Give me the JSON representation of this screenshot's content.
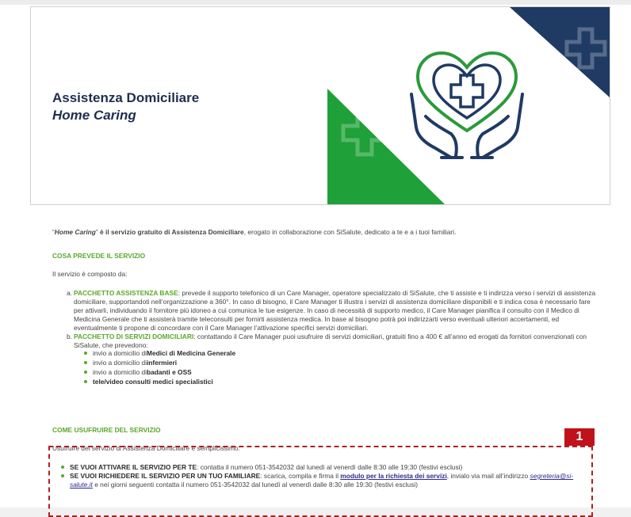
{
  "hero": {
    "title": "Assistenza Domiciliare",
    "subtitle": "Home Caring"
  },
  "intro": {
    "quote_open": "“",
    "name": "Home Caring",
    "quote_close": "”",
    "mid1": " è il servizio gratuito di ",
    "bold": "Assistenza Domiciliare",
    "rest": ", erogato in collaborazione con SiSalute, dedicato a te e a i tuoi familiari."
  },
  "section1": {
    "heading": "COSA PREVEDE IL SERVIZIO",
    "composed": "Il servizio è composto da:",
    "items": [
      {
        "marker": "a.",
        "title": "PACCHETTO ASSISTENZA BASE",
        "text": ": prevede il supporto telefonico di un Care Manager, operatore specializzato di SiSalute, che ti assiste e ti indirizza verso i servizi di assistenza domiciliare, supportandoti nell’organizzazione a 360°. In caso di bisogno, il Care Manager ti illustra i servizi di assistenza domiciliare disponibili e ti indica cosa è necessario fare per attivarli, individuando il fornitore più idoneo a cui comunica le tue esigenze. In caso di necessità di supporto medico, il Care Manager pianifica il consulto con il Medico di Medicina Generale che ti assisterà tramite teleconsulti per fornirti assistenza medica. In base al bisogno potrà poi indirizzarti verso eventuali ulteriori accertamenti, ed eventualmente ti propone di concordare con il Care Manager l’attivazione specifici servizi domiciliari."
      },
      {
        "marker": "b.",
        "title": "PACCHETTO DI SERVIZI DOMICILIARI",
        "text": ": contattando il Care Manager puoi usufruire di servizi domiciliari, gratuiti fino a 400 € all’anno ed erogati da fornitori convenzionati con SiSalute, che prevedono:"
      }
    ],
    "bullets": [
      {
        "pre": "invio a domicilio di ",
        "bold": "Medici di Medicina Generale"
      },
      {
        "pre": "invio a domicilio di ",
        "bold": "infermieri"
      },
      {
        "pre": "invio a domicilio di ",
        "bold": "badanti e OSS"
      },
      {
        "pre": "",
        "bold": "tele/video consulti medici specialistici"
      }
    ]
  },
  "section2": {
    "heading": "COME USUFRUIRE DEL SERVIZIO",
    "usufruire": "Usufruire del servizio di Assistenza Domiciliare è semplicissimo:",
    "step1": {
      "bold": "SE VUOI ATTIVARE IL SERVIZIO PER TE",
      "text": ": contatta il numero 051-3542032 dal lunedì al venerdì dalle 8:30  alle 19:30 (festivi esclusi)"
    },
    "step2": {
      "bold": "SE VUOI  RICHIEDERE IL SERVIZIO PER UN TUO FAMILIARE",
      "text1": ": scarica, compila e firma il ",
      "link": "modulo per la richiesta dei servizi",
      "text2": ", invialo via mail all’indirizzo ",
      "mail": "segreteria@si-salute.it",
      "text3": " e nei giorni seguenti contatta il numero 051-3542032 dal lunedì al venerdì dalle 8:30  alle 19:30 (festivi esclusi)"
    }
  },
  "callout": {
    "badge": "1"
  },
  "colors": {
    "green": "#5aa82a",
    "navy": "#1f3a63",
    "callout_red": "#c0121a"
  }
}
